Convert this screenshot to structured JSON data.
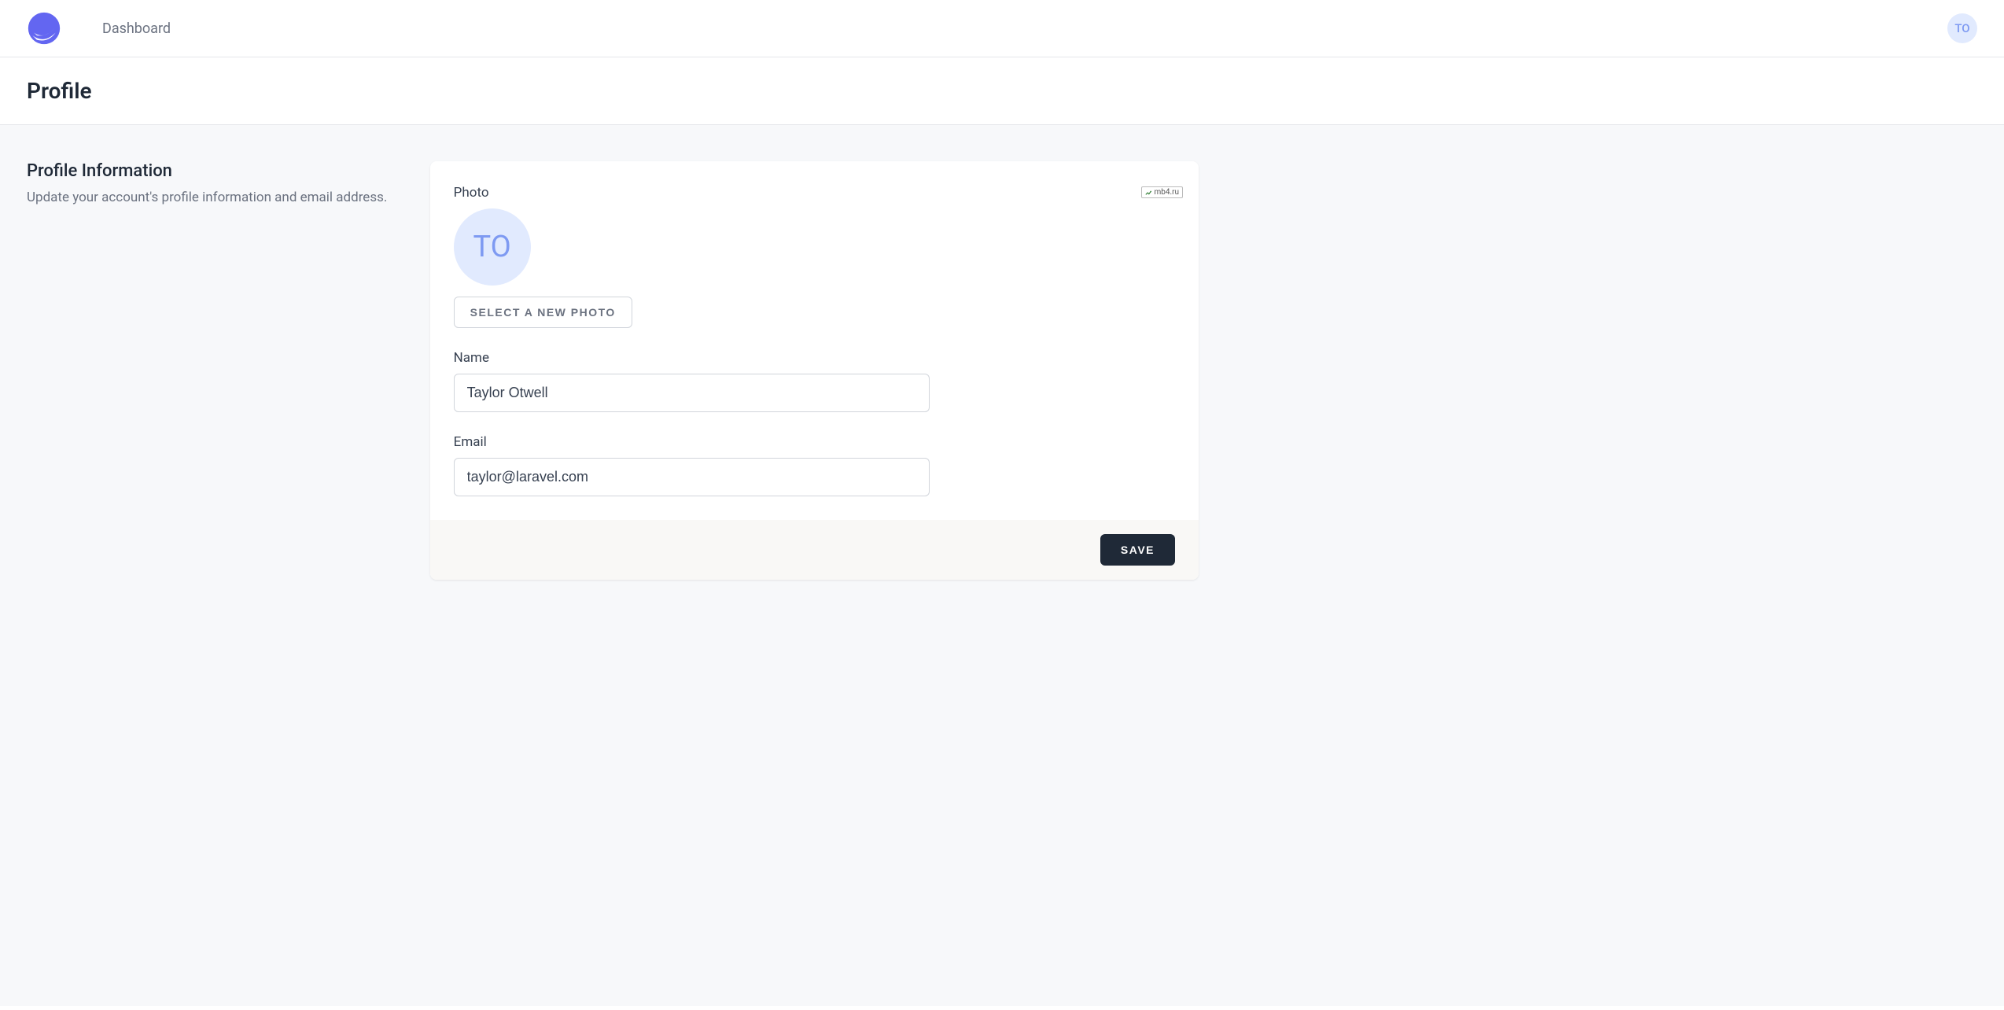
{
  "nav": {
    "dashboard_label": "Dashboard",
    "avatar_initials": "TO"
  },
  "header": {
    "title": "Profile"
  },
  "section": {
    "title": "Profile Information",
    "description": "Update your account's profile information and email address."
  },
  "form": {
    "photo_label": "Photo",
    "avatar_initials": "TO",
    "select_photo_label": "Select A New Photo",
    "name_label": "Name",
    "name_value": "Taylor Otwell",
    "email_label": "Email",
    "email_value": "taylor@laravel.com",
    "save_label": "Save"
  },
  "watermark": {
    "text": "mb4.ru"
  }
}
